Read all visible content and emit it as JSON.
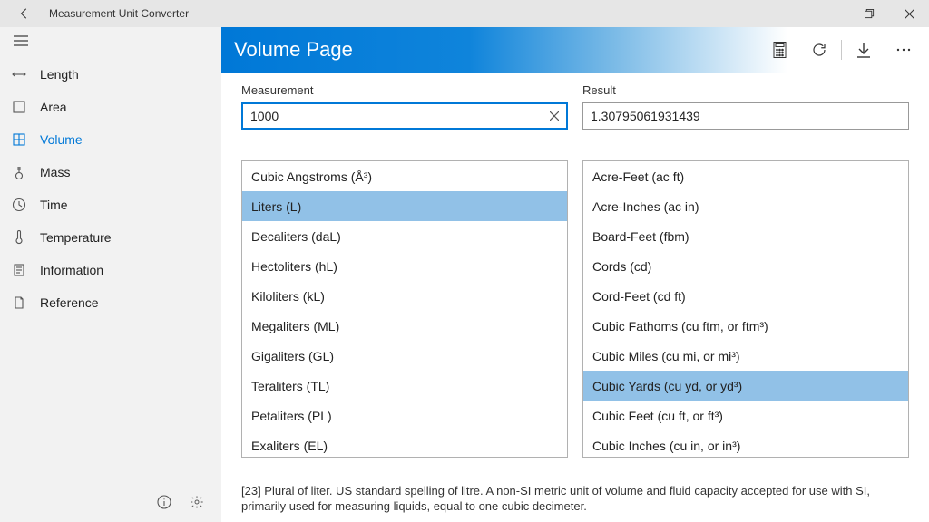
{
  "app": {
    "title": "Measurement Unit Converter"
  },
  "sidebar": {
    "items": [
      {
        "label": "Length"
      },
      {
        "label": "Area"
      },
      {
        "label": "Volume"
      },
      {
        "label": "Mass"
      },
      {
        "label": "Time"
      },
      {
        "label": "Temperature"
      },
      {
        "label": "Information"
      },
      {
        "label": "Reference"
      }
    ],
    "active_index": 2
  },
  "header": {
    "page_title": "Volume Page"
  },
  "input": {
    "measurement_label": "Measurement",
    "measurement_value": "1000",
    "result_label": "Result",
    "result_value": "1.30795061931439"
  },
  "from_units": [
    "Cubic Angstroms  (Å³)",
    "Liters  (L)",
    "Decaliters  (daL)",
    "Hectoliters  (hL)",
    "Kiloliters  (kL)",
    "Megaliters  (ML)",
    "Gigaliters  (GL)",
    "Teraliters  (TL)",
    "Petaliters  (PL)",
    "Exaliters  (EL)"
  ],
  "from_selected_index": 1,
  "to_units": [
    "Acre-Feet  (ac ft)",
    "Acre-Inches  (ac in)",
    "Board-Feet  (fbm)",
    "Cords  (cd)",
    "Cord-Feet  (cd ft)",
    "Cubic Fathoms  (cu ftm, or ftm³)",
    "Cubic Miles  (cu mi, or mi³)",
    "Cubic Yards  (cu yd, or yd³)",
    "Cubic Feet  (cu ft, or ft³)",
    "Cubic Inches  (cu in, or in³)"
  ],
  "to_selected_index": 7,
  "description": "[23]  Plural of liter. US standard spelling of litre. A non-SI metric unit of volume and fluid capacity accepted for use with SI, primarily used for measuring liquids, equal to one cubic decimeter."
}
